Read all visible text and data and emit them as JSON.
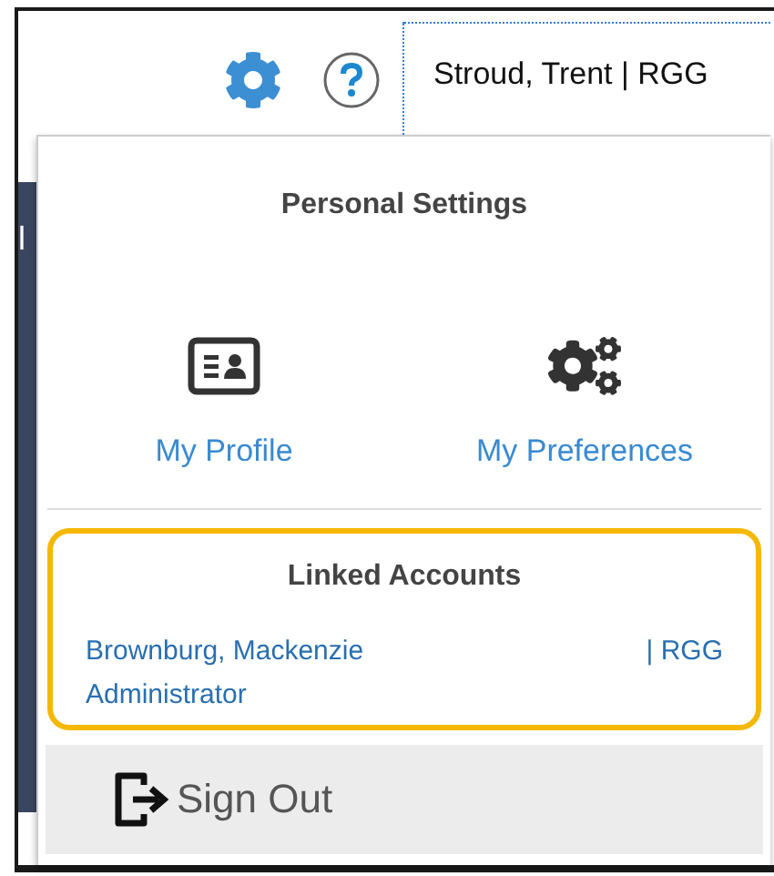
{
  "background_text": "l",
  "user_menu": {
    "label": "Stroud, Trent | RGG"
  },
  "panel": {
    "title": "Personal Settings",
    "links": [
      {
        "label": "My Profile",
        "kind": "profile"
      },
      {
        "label": "My Preferences",
        "kind": "preferences"
      }
    ],
    "linked_accounts": {
      "title": "Linked Accounts",
      "accounts": [
        {
          "name": "Brownburg, Mackenzie",
          "org": "| RGG",
          "role": "Administrator"
        }
      ]
    },
    "sign_out": "Sign Out"
  }
}
